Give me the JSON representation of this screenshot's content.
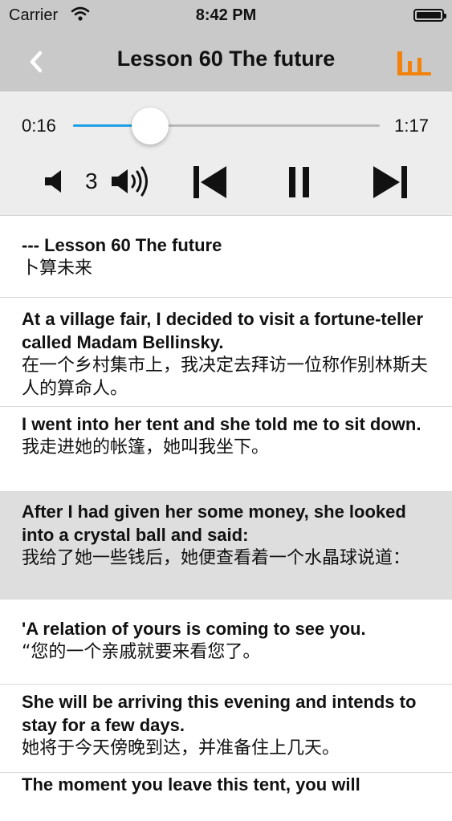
{
  "status_bar": {
    "carrier": "Carrier",
    "time": "8:42 PM"
  },
  "nav": {
    "title": "Lesson 60 The future",
    "accent_color": "#f2820c"
  },
  "player": {
    "current_time": "0:16",
    "duration": "1:17",
    "progress_fraction": 0.25,
    "volume_level": "3",
    "track_color": "#1ea0e6"
  },
  "sentences": [
    {
      "en": "--- Lesson 60  The future",
      "zh": "卜算未来"
    },
    {
      "en": "At a village fair, I decided to visit a fortune-teller called Madam Bellinsky.",
      "zh": "在一个乡村集市上，我决定去拜访一位称作别林斯夫人的算命人。"
    },
    {
      "en": "I went into her tent and she told me to sit down.",
      "zh": "我走进她的帐篷，她叫我坐下。"
    },
    {
      "en": "After I had given her some money, she looked into a crystal ball and said:",
      "zh": "我给了她一些钱后，她便查看着一个水晶球说道：",
      "highlighted": true
    },
    {
      "en": "'A relation of yours is coming to see you.",
      "zh": "“您的一个亲戚就要来看您了。"
    },
    {
      "en": "She will be arriving this evening and intends to stay for a few days.",
      "zh": "她将于今天傍晚到达，并准备住上几天。"
    },
    {
      "en": "The moment you leave this tent, you will",
      "zh": ""
    }
  ]
}
